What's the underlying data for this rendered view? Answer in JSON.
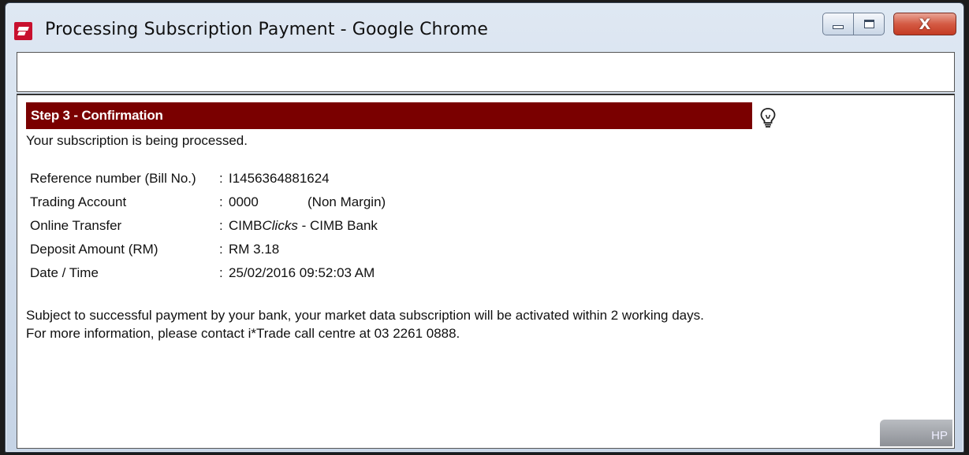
{
  "window": {
    "title": "Processing Subscription Payment - Google Chrome",
    "app_icon": "chrome-app-icon",
    "controls": {
      "minimize": "minimize-icon",
      "maximize": "maximize-icon",
      "close_glyph": "X"
    }
  },
  "address_bar": {
    "value": ""
  },
  "step": {
    "title": "Step 3 - Confirmation",
    "header_color": "#7a0000",
    "hint_icon": "lightbulb-icon"
  },
  "status_message": "Your subscription is being processed.",
  "details": [
    {
      "label": "Reference number (Bill No.)",
      "sep": ":",
      "value": "I1456364881624",
      "extra": ""
    },
    {
      "label": "Trading Account",
      "sep": ":",
      "value": "0000",
      "extra": "(Non Margin)"
    },
    {
      "label": "Online Transfer",
      "sep": ":",
      "value_prefix": "CIMB",
      "value_italic": "Clicks",
      "value_suffix": " - CIMB Bank"
    },
    {
      "label": "Deposit Amount (RM)",
      "sep": ":",
      "value": "RM 3.18",
      "extra": ""
    },
    {
      "label": "Date / Time",
      "sep": ":",
      "value": "25/02/2016 09:52:03 AM",
      "extra": ""
    }
  ],
  "notes": [
    "Subject to successful payment by your bank, your market data subscription will be activated within 2 working days.",
    "For more information, please contact i*Trade call centre at 03 2261 0888."
  ],
  "taskbar_badge": "HP"
}
